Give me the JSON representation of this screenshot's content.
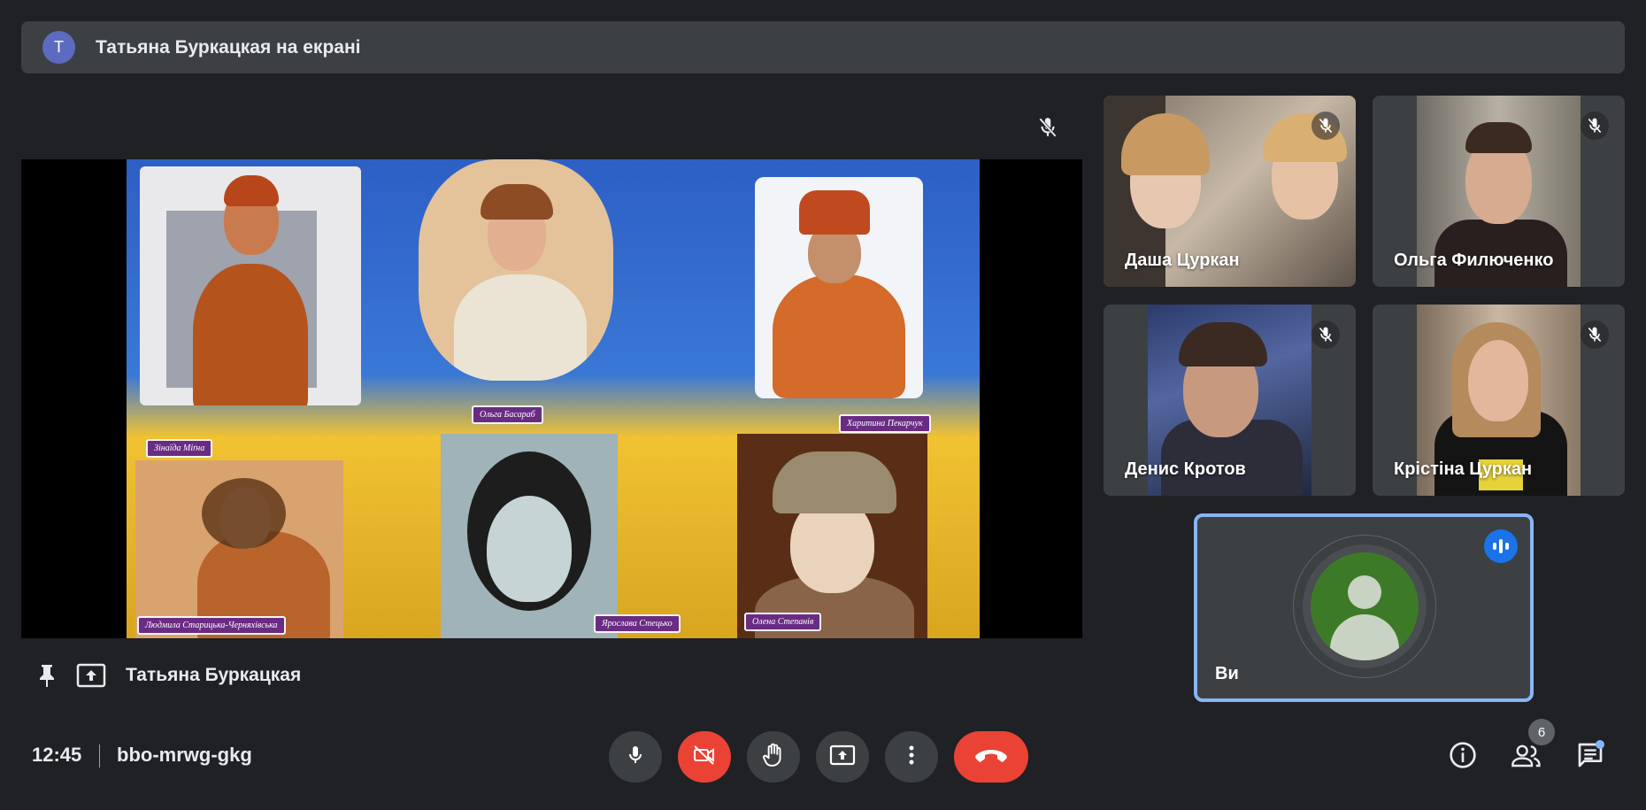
{
  "banner": {
    "avatar_letter": "T",
    "text": "Татьяна Буркацкая на екрані"
  },
  "share": {
    "presenter_name": "Татьяна Буркацкая",
    "slide_names": [
      "Зінаїда Міґна",
      "Ольга Басараб",
      "Харитина Пекарчук",
      "Людмила Старицька-Черняхівська",
      "Ярослава Стецько",
      "Олена Степанів"
    ]
  },
  "participants": [
    {
      "name": "Даша Цуркан",
      "muted": true
    },
    {
      "name": "Ольга Филюченко",
      "muted": true
    },
    {
      "name": "Денис Кротов",
      "muted": true
    },
    {
      "name": "Крістіна Цуркан",
      "muted": true
    }
  ],
  "self": {
    "name": "Ви",
    "speaking": true,
    "avatar_color": "#3d7a27"
  },
  "meeting": {
    "time": "12:45",
    "code": "bbo-mrwg-gkg"
  },
  "controls": [
    "mic-icon",
    "camera-off-icon",
    "raise-hand-icon",
    "present-icon",
    "more-vert-icon",
    "end-call-icon"
  ],
  "right_controls": {
    "people_count": "6"
  },
  "colors": {
    "background": "#202124",
    "surface": "#3c4043",
    "danger": "#ea4335",
    "accent": "#8ab4f8"
  }
}
